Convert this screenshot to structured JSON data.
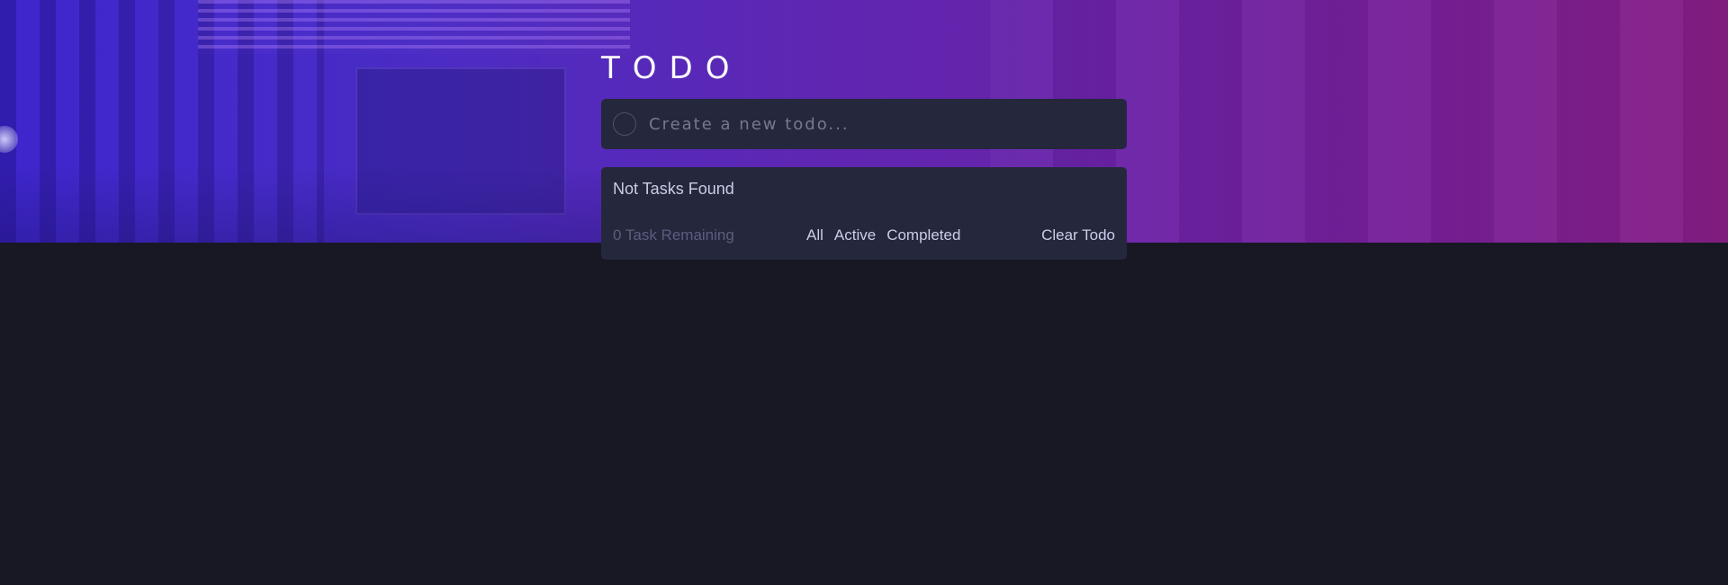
{
  "app": {
    "title": "TODO"
  },
  "new_todo": {
    "placeholder": "Create a new todo...",
    "value": ""
  },
  "list": {
    "empty_message": "Not Tasks Found",
    "items": []
  },
  "footer": {
    "remaining": "0 Task Remaining",
    "filters": [
      {
        "label": "All"
      },
      {
        "label": "Active"
      },
      {
        "label": "Completed"
      }
    ],
    "clear_label": "Clear Todo"
  },
  "colors": {
    "background": "#181824",
    "card": "#25273c",
    "text": "#cacde8",
    "muted": "#5b5e7e",
    "hero_gradient_start": "#3a23c9",
    "hero_gradient_end": "#861e84"
  },
  "icons": {
    "check_circle": "circle-outline-icon"
  }
}
